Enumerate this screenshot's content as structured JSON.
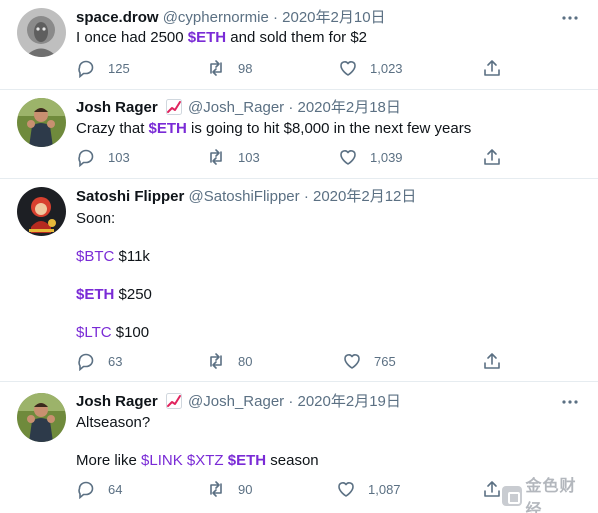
{
  "tweets": [
    {
      "display_name": "space.drow",
      "handle": "@cyphernormie",
      "separator": "·",
      "date": "2020年2月10日",
      "avatar": "avatar-grey-hooded-figure",
      "badge": "",
      "text_parts": [
        "I once had 2500 ",
        "$ETH",
        " and sold them for $2"
      ],
      "reply_count": "125",
      "retweet_count": "98",
      "like_count": "1,023"
    },
    {
      "display_name": "Josh Rager",
      "handle": "@Josh_Rager",
      "separator": "·",
      "date": "2020年2月18日",
      "avatar": "avatar-person-outdoors",
      "badge": "chart-increasing-emoji",
      "text_parts": [
        "Crazy that ",
        "$ETH",
        " is going to hit $8,000 in the next few years"
      ],
      "reply_count": "103",
      "retweet_count": "103",
      "like_count": "1,039"
    },
    {
      "display_name": "Satoshi Flipper",
      "handle": "@SatoshiFlipper",
      "separator": "·",
      "date": "2020年2月12日",
      "avatar": "avatar-red-character",
      "badge": "",
      "lines": [
        {
          "text": "Soon:"
        },
        {
          "cashtag": "$BTC",
          "rest": " $11k",
          "bold": false
        },
        {
          "cashtag": "$ETH",
          "rest": " $250",
          "bold": true
        },
        {
          "cashtag": "$LTC",
          "rest": " $100",
          "bold": false
        }
      ],
      "reply_count": "63",
      "retweet_count": "80",
      "like_count": "765"
    },
    {
      "display_name": "Josh Rager",
      "handle": "@Josh_Rager",
      "separator": "·",
      "date": "2020年2月19日",
      "avatar": "avatar-person-outdoors",
      "badge": "chart-increasing-emoji",
      "line1": "Altseason?",
      "line2_parts": [
        "More like ",
        "$LINK",
        " ",
        "$XTZ",
        " ",
        "$ETH",
        " season"
      ],
      "reply_count": "64",
      "retweet_count": "90",
      "like_count": "1,087"
    }
  ],
  "watermark": {
    "text": "金色财经",
    "icon": "jinse-logo-icon"
  },
  "colors": {
    "cashtag": "#7a2bd6",
    "secondary_text": "#5b7083",
    "divider": "#e6ecf0",
    "text": "#0f1419"
  }
}
